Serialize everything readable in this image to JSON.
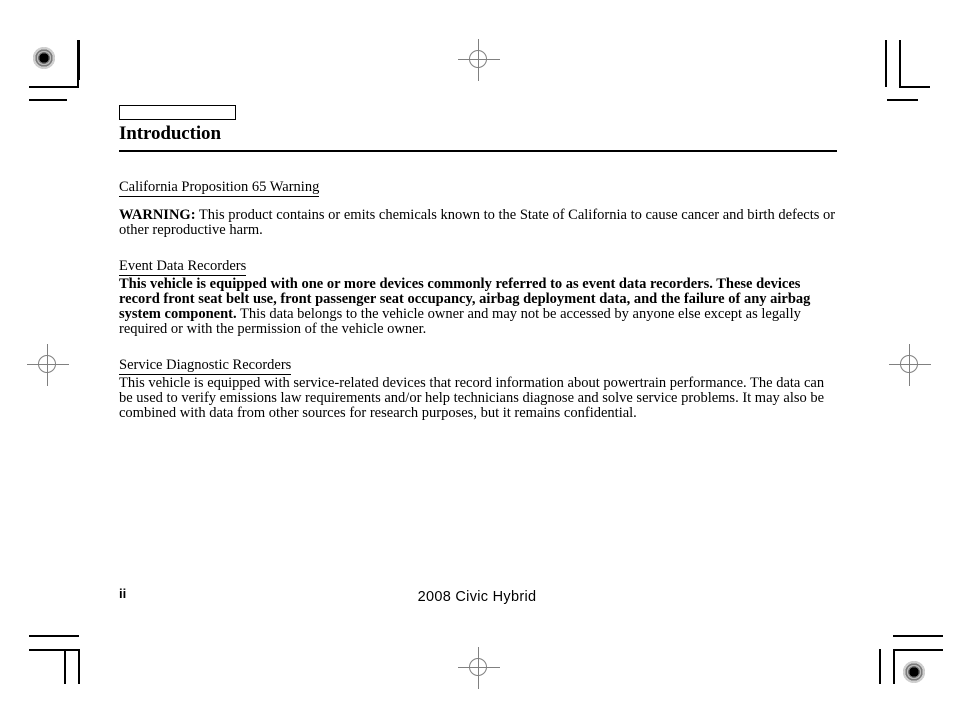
{
  "document": {
    "section_label": "",
    "title": "Introduction",
    "sections": [
      {
        "heading": "California Proposition 65 Warning",
        "lead_bold": "WARNING:",
        "body": " This product contains or emits chemicals known to the State of California to cause cancer and birth defects or other reproductive harm."
      },
      {
        "heading": "Event Data Recorders",
        "lead_bold": "This vehicle is equipped with one or more devices commonly referred to as event data recorders. These devices record front seat belt use, front passenger seat occupancy, airbag deployment data, and the failure of any airbag system component.",
        "body": " This data belongs to the vehicle owner and may not be accessed by anyone else except as legally required or with the permission of the vehicle owner."
      },
      {
        "heading": "Service Diagnostic Recorders",
        "lead_bold": "",
        "body": "This vehicle is equipped with service-related devices that record information about powertrain performance. The data can be used to verify emissions law requirements and/or help technicians diagnose and solve service problems. It may also be combined with data from other sources for research purposes, but it remains confidential."
      }
    ]
  },
  "footer": {
    "page_number": "ii",
    "model": "2008  Civic  Hybrid"
  },
  "print_marks": {
    "registration_target_top_left": "registration-target",
    "registration_target_bottom_right": "registration-target",
    "crosshair_top": "registration-crosshair",
    "crosshair_bottom": "registration-crosshair",
    "crosshair_left": "registration-crosshair",
    "crosshair_right": "registration-crosshair"
  },
  "colors": {
    "ink": "#000000",
    "mark_gray": "#808080",
    "background": "#ffffff"
  }
}
